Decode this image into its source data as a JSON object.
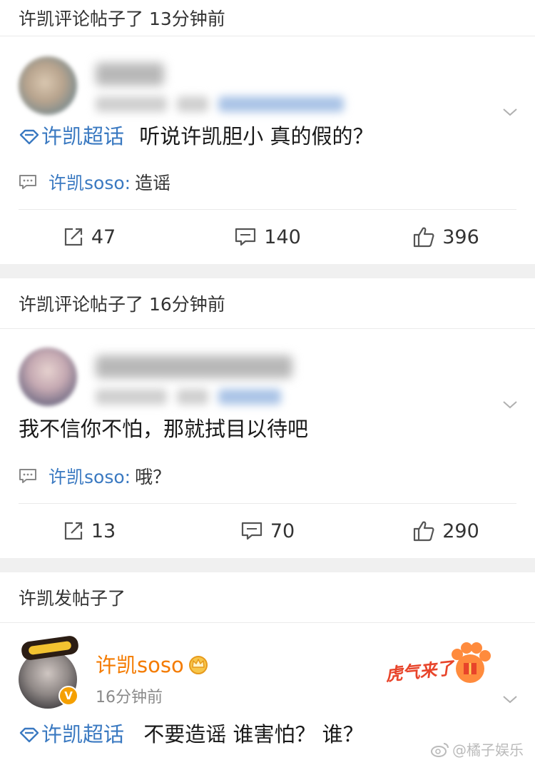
{
  "feed": [
    {
      "header": "许凯评论帖子了 13分钟前",
      "post": {
        "topic": "许凯超话",
        "text": "听说许凯胆小 真的假的？",
        "reply_user": "许凯soso:",
        "reply_text": "造谣",
        "reposts": "47",
        "comments": "140",
        "likes": "396"
      }
    },
    {
      "header": "许凯评论帖子了 16分钟前",
      "post": {
        "text": "我不信你不怕，那就拭目以待吧",
        "reply_user": "许凯soso:",
        "reply_text": "哦？",
        "reposts": "13",
        "comments": "70",
        "likes": "290"
      }
    },
    {
      "header": "许凯发帖子了",
      "post": {
        "username": "许凯soso",
        "time": "16分钟前",
        "verified_badge": "V",
        "sticker_text": "虎气来了",
        "topic": "许凯超话",
        "text": "不要造谣 谁害怕？ 谁？"
      }
    }
  ],
  "watermark": "@橘子娱乐",
  "colors": {
    "link": "#3a79c1",
    "gap": "#f0f0f0",
    "divider": "#eaeaea",
    "sticker": "#e8442a"
  }
}
